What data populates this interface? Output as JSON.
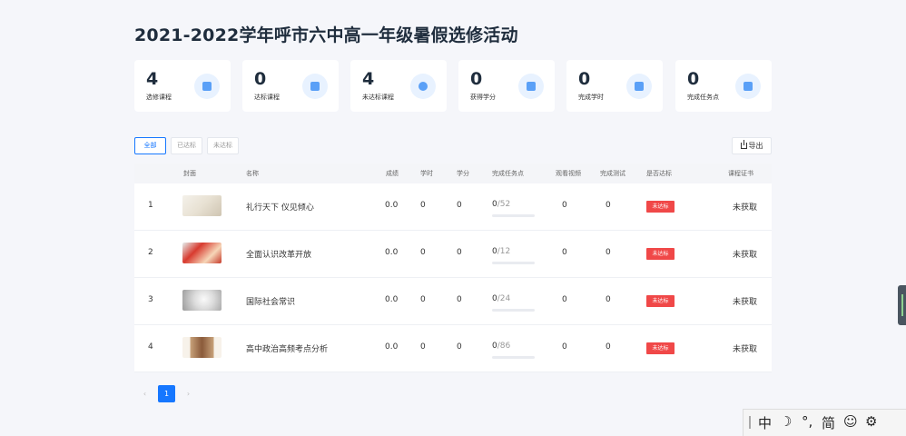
{
  "page_title": "2021-2022学年呼市六中高一年级暑假选修活动",
  "stats": [
    {
      "value": "4",
      "label": "选修课程",
      "icon": "book-icon"
    },
    {
      "value": "0",
      "label": "达标课程",
      "icon": "check-icon"
    },
    {
      "value": "4",
      "label": "未达标课程",
      "icon": "close-circle-icon"
    },
    {
      "value": "0",
      "label": "获得学分",
      "icon": "credit-icon"
    },
    {
      "value": "0",
      "label": "完成学时",
      "icon": "calendar-icon"
    },
    {
      "value": "0",
      "label": "完成任务点",
      "icon": "task-icon"
    }
  ],
  "filters": {
    "all": "全部",
    "passed": "已达标",
    "not_passed": "未达标"
  },
  "export_label": "导出",
  "table": {
    "headers": {
      "cover": "封面",
      "name": "名称",
      "score": "成绩",
      "hours": "学时",
      "credits": "学分",
      "tasks": "完成任务点",
      "videos": "观看视频",
      "tests": "完成测试",
      "passed": "是否达标",
      "certificate": "课程证书"
    },
    "rows": [
      {
        "index": "1",
        "name": "礼行天下 仪见倾心",
        "score": "0.0",
        "hours": "0",
        "credits": "0",
        "tasks_done": "0",
        "tasks_total": "/52",
        "tasks_progress": 0,
        "videos": "0",
        "tests": "0",
        "status": "未达标",
        "certificate": "未获取"
      },
      {
        "index": "2",
        "name": "全面认识改革开放",
        "score": "0.0",
        "hours": "0",
        "credits": "0",
        "tasks_done": "0",
        "tasks_total": "/12",
        "tasks_progress": 0,
        "videos": "0",
        "tests": "0",
        "status": "未达标",
        "certificate": "未获取"
      },
      {
        "index": "3",
        "name": "国际社会常识",
        "score": "0.0",
        "hours": "0",
        "credits": "0",
        "tasks_done": "0",
        "tasks_total": "/24",
        "tasks_progress": 0,
        "videos": "0",
        "tests": "0",
        "status": "未达标",
        "certificate": "未获取"
      },
      {
        "index": "4",
        "name": "高中政治高频考点分析",
        "score": "0.0",
        "hours": "0",
        "credits": "0",
        "tasks_done": "0",
        "tasks_total": "/86",
        "tasks_progress": 0,
        "videos": "0",
        "tests": "0",
        "status": "未达标",
        "certificate": "未获取"
      }
    ]
  },
  "pagination": {
    "prev": "‹",
    "current": "1",
    "next": "›"
  },
  "ime_toolbar": {
    "mode": "中",
    "moon": "☽",
    "punct": "°,",
    "simplified": "简",
    "emoji": "☺",
    "settings": "⚙"
  },
  "colors": {
    "accent": "#1677ff",
    "badge": "#f04848",
    "icon": "#5aa0f7"
  }
}
